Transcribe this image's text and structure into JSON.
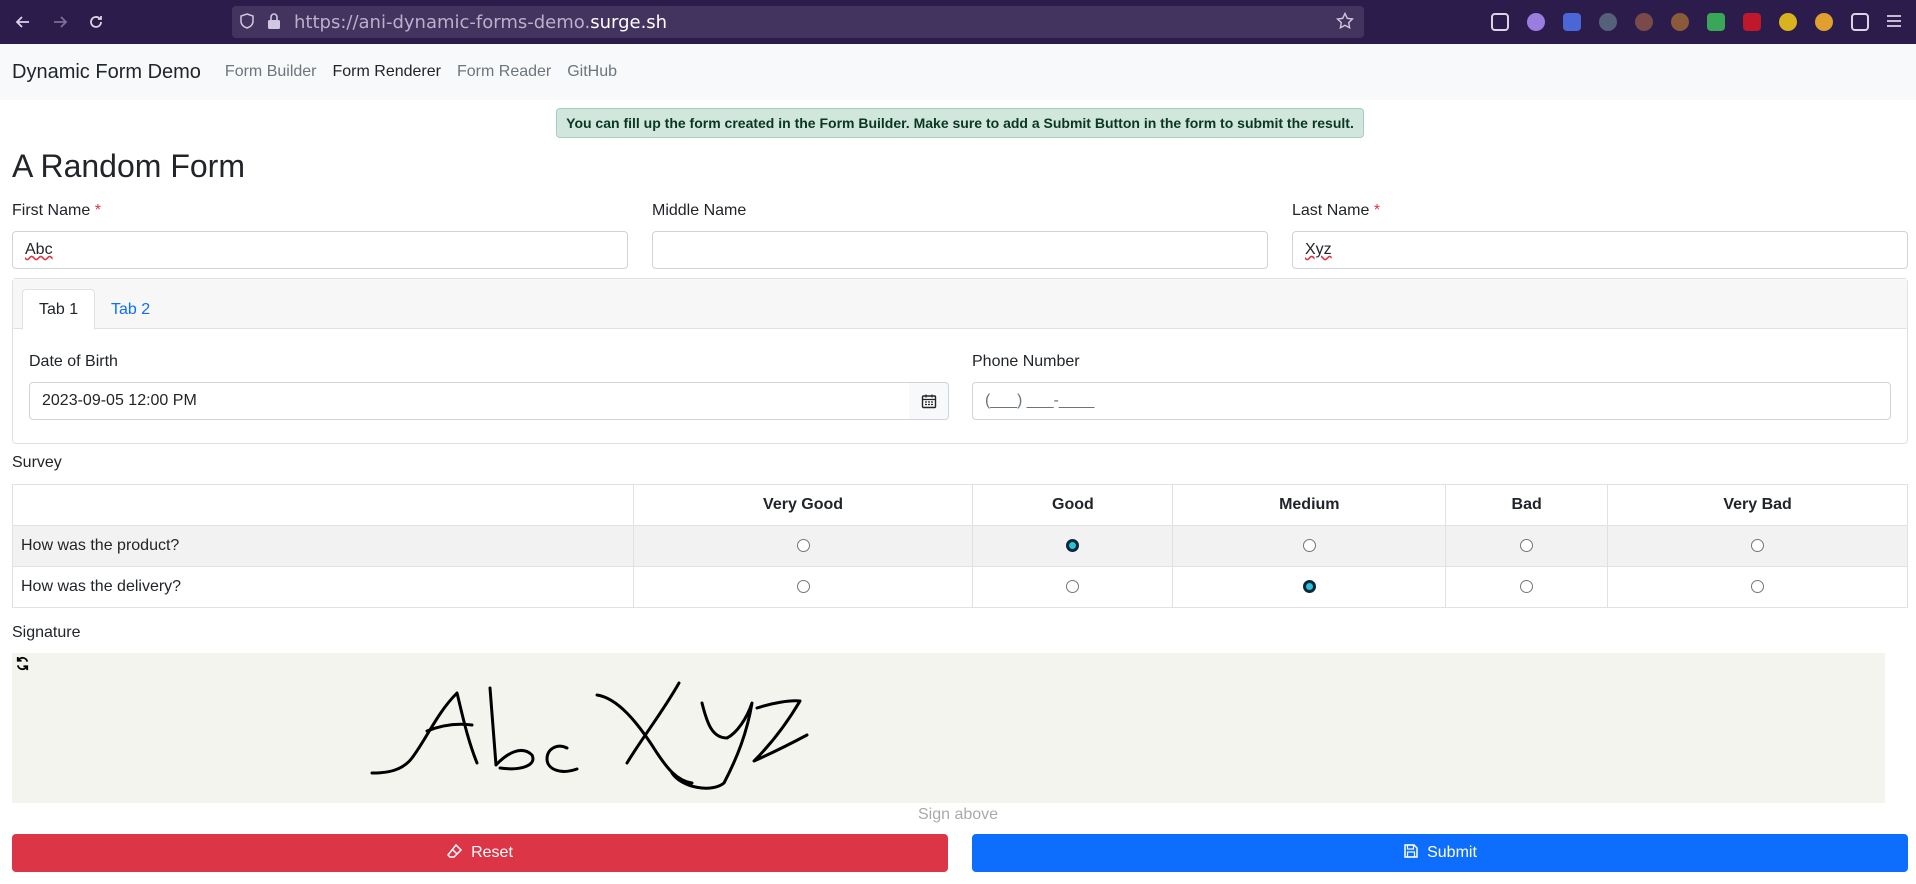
{
  "browser": {
    "url_prefix": "https://ani-dynamic-forms-demo.",
    "url_domain": "surge.sh"
  },
  "navbar": {
    "brand": "Dynamic Form Demo",
    "links": [
      "Form Builder",
      "Form Renderer",
      "Form Reader",
      "GitHub"
    ],
    "active_link": "Form Renderer"
  },
  "alert": "You can fill up the form created in the Form Builder. Make sure to add a Submit Button in the form to submit the result.",
  "form": {
    "title": "A Random Form",
    "first_name": {
      "label": "First Name",
      "value": "Abc",
      "required": "*"
    },
    "middle_name": {
      "label": "Middle Name",
      "value": ""
    },
    "last_name": {
      "label": "Last Name",
      "value": "Xyz",
      "required": "*"
    },
    "tabs": [
      "Tab 1",
      "Tab 2"
    ],
    "active_tab": "Tab 1",
    "dob": {
      "label": "Date of Birth",
      "value": "2023-09-05 12:00 PM"
    },
    "phone": {
      "label": "Phone Number",
      "value": "(___) ___-____"
    },
    "survey": {
      "label": "Survey",
      "columns": [
        "Very Good",
        "Good",
        "Medium",
        "Bad",
        "Very Bad"
      ],
      "rows": [
        {
          "question": "How was the product?",
          "selected": "Good"
        },
        {
          "question": "How was the delivery?",
          "selected": "Medium"
        }
      ]
    },
    "signature": {
      "label": "Signature",
      "hint": "Sign above",
      "signed_text": "Abc Xyz"
    },
    "buttons": {
      "reset": "Reset",
      "submit": "Submit"
    }
  },
  "colors": {
    "reset": "#dc3545",
    "submit": "#0d6efd",
    "alert_bg": "#d1e7dd",
    "chrome": "#2b1c4c"
  }
}
